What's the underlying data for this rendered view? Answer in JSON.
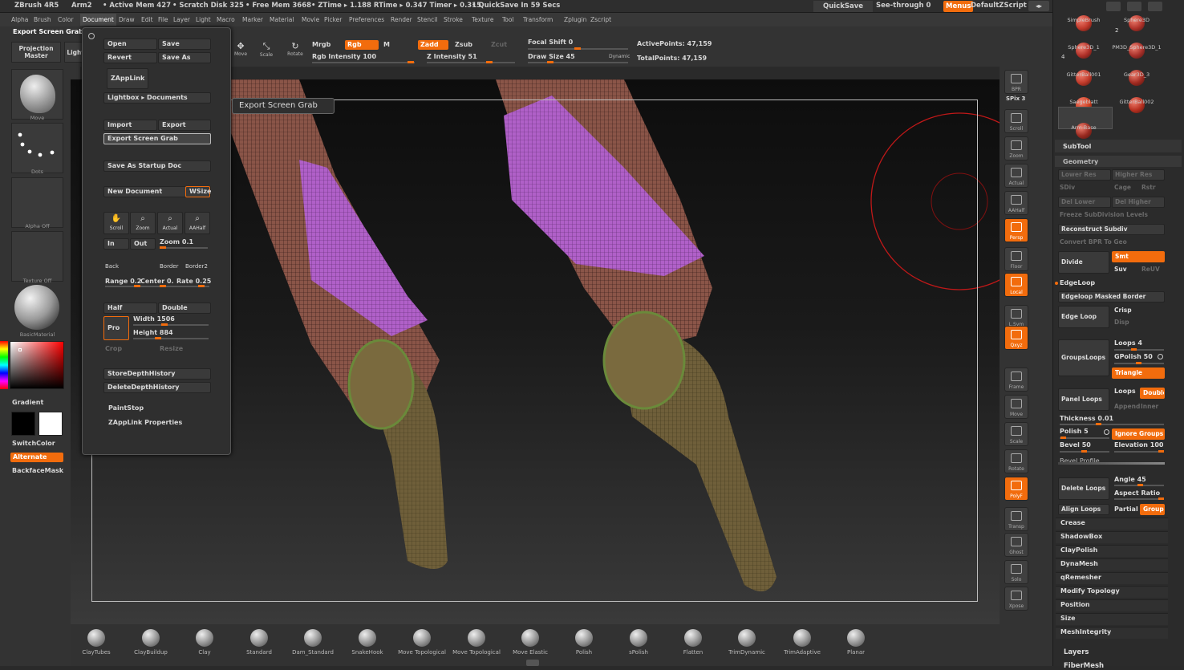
{
  "titlebar": {
    "app": "ZBrush 4R5",
    "doc": "Arm2",
    "active_mem": "• Active Mem 427",
    "scratch": "• Scratch Disk 325",
    "free_mem": "• Free Mem 3668",
    "ztime": "• ZTime ▸ 1.188 RTime ▸ 0.347 Timer ▸ 0.315",
    "quicksave_in": "• QuickSave In 59 Secs",
    "quicksave": "QuickSave",
    "seethrough": "See-through  0",
    "menus": "Menus",
    "script": "DefaultZScript"
  },
  "menubar": [
    "Alpha",
    "Brush",
    "Color",
    "Document",
    "Draw",
    "Edit",
    "File",
    "Layer",
    "Light",
    "Macro",
    "Marker",
    "Material",
    "Movie",
    "Picker",
    "Preferences",
    "Render",
    "Stencil",
    "Stroke",
    "Texture",
    "Tool",
    "Transform",
    "Zplugin",
    "Zscript"
  ],
  "topshelf": {
    "popup_title": "Export Screen Grab",
    "projection_master": "Projection Master",
    "lightbox": "LightBox",
    "move": "Move",
    "scale": "Scale",
    "rotate": "Rotate",
    "mrgb": "Mrgb",
    "rgb": "Rgb",
    "m": "M",
    "rgb_intensity": "Rgb Intensity 100",
    "zadd": "Zadd",
    "zsub": "Zsub",
    "zcut": "Zcut",
    "z_intensity": "Z Intensity 51",
    "focal_shift": "Focal Shift 0",
    "draw_size": "Draw Size 45",
    "dynamic": "Dynamic",
    "active_points": "ActivePoints: 47,159",
    "total_points": "TotalPoints: 47,159"
  },
  "leftshelf": {
    "move": "Move",
    "dots": "Dots",
    "alpha_off": "Alpha Off",
    "texture_off": "Texture Off",
    "basic_material": "BasicMaterial",
    "gradient": "Gradient",
    "switch_color": "SwitchColor",
    "alternate": "Alternate",
    "backface_mask": "BackfaceMask"
  },
  "popup": {
    "open": "Open",
    "save": "Save",
    "revert": "Revert",
    "save_as": "Save As",
    "zapplink": "ZAppLink",
    "lightbox_docs": "Lightbox ▸ Documents",
    "import": "Import",
    "export": "Export",
    "export_screen_grab": "Export Screen Grab",
    "save_startup": "Save As Startup Doc",
    "new_document": "New Document",
    "wsize": "WSize",
    "scroll": "Scroll",
    "zoom": "Zoom",
    "actual": "Actual",
    "aahalf": "AAHalf",
    "in": "In",
    "out": "Out",
    "zoom_val": "Zoom 0.1",
    "back": "Back",
    "border": "Border",
    "border2": "Border2",
    "range": "Range 0.2",
    "center": "Center 0.",
    "rate": "Rate 0.25",
    "half": "Half",
    "double": "Double",
    "pro": "Pro",
    "width": "Width 1506",
    "height": "Height 884",
    "crop": "Crop",
    "resize": "Resize",
    "store_depth": "StoreDepthHistory",
    "delete_depth": "DeleteDepthHistory",
    "paintstop": "PaintStop",
    "zapplink_props": "ZAppLink Properties",
    "tooltip": "Export Screen Grab"
  },
  "righttoolbar": [
    {
      "name": "bpr",
      "label": "BPR",
      "on": false
    },
    {
      "name": "scroll",
      "label": "Scroll",
      "on": false
    },
    {
      "name": "zoom",
      "label": "Zoom",
      "on": false
    },
    {
      "name": "actual",
      "label": "Actual",
      "on": false
    },
    {
      "name": "aahalf",
      "label": "AAHalf",
      "on": false
    },
    {
      "name": "persp",
      "label": "Persp",
      "on": true
    },
    {
      "name": "floor",
      "label": "Floor",
      "on": false
    },
    {
      "name": "local",
      "label": "Local",
      "on": true
    },
    {
      "name": "lsym",
      "label": "L.Sym",
      "on": false
    },
    {
      "name": "xyz",
      "label": "Qxyz",
      "on": true
    },
    {
      "name": "frame",
      "label": "Frame",
      "on": false
    },
    {
      "name": "move",
      "label": "Move",
      "on": false
    },
    {
      "name": "scale",
      "label": "Scale",
      "on": false
    },
    {
      "name": "rotate",
      "label": "Rotate",
      "on": false
    },
    {
      "name": "polyf",
      "label": "PolyF",
      "on": true
    },
    {
      "name": "transp",
      "label": "Transp",
      "on": false
    },
    {
      "name": "ghost",
      "label": "Ghost",
      "on": false
    },
    {
      "name": "solo",
      "label": "Solo",
      "on": false
    },
    {
      "name": "xpose",
      "label": "Xpose",
      "on": false
    }
  ],
  "spix": "SPix 3",
  "rightpanel": {
    "tools": [
      "SimpleBrush",
      "Sphere3D",
      "Sphere3D_1",
      "PM3D_Sphere3D_1",
      "GitterBall001",
      "Gear3D_3",
      "Saegeblatt",
      "GitterBall002",
      "Arm-Base"
    ],
    "tool_counts": [
      "2",
      "4"
    ],
    "subtool": "SubTool",
    "geometry": "Geometry",
    "lower_res": "Lower Res",
    "higher_res": "Higher Res",
    "sdiv": "SDiv",
    "cage": "Cage",
    "rstr": "Rstr",
    "del_lower": "Del Lower",
    "del_higher": "Del Higher",
    "freeze": "Freeze SubDivision Levels",
    "reconstruct": "Reconstruct Subdiv",
    "convert_bpr": "Convert BPR To Geo",
    "divide": "Divide",
    "smt": "Smt",
    "suv": "Suv",
    "reuv": "ReUV",
    "edgeloop": "EdgeLoop",
    "edgeloop_masked": "Edgeloop Masked Border",
    "edge_loop": "Edge Loop",
    "crisp": "Crisp",
    "disp": "Disp",
    "loops4": "Loops 4",
    "gpolish": "GPolish 50",
    "groupsloops": "GroupsLoops",
    "triangle": "Triangle",
    "panel_loops": "Panel Loops",
    "loops": "Loops",
    "double": "Double",
    "append": "Append",
    "inner": "Inner",
    "thickness": "Thickness 0.01",
    "polish": "Polish 5",
    "ignore_groups": "Ignore Groups",
    "bevel": "Bevel 50",
    "elevation": "Elevation 100",
    "bevel_profile": "Bevel Profile",
    "delete_loops": "Delete Loops",
    "angle": "Angle 45",
    "aspect_ratio": "Aspect Ratio",
    "align_loops": "Align Loops",
    "partial": "Partial",
    "groups": "Groups",
    "sections": [
      "Crease",
      "ShadowBox",
      "ClayPolish",
      "DynaMesh",
      "qRemesher",
      "Modify Topology",
      "Position",
      "Size",
      "MeshIntegrity"
    ],
    "layers": "Layers",
    "fibermesh": "FiberMesh"
  },
  "bottomshelf": [
    "ClayTubes",
    "ClayBuildup",
    "Clay",
    "Standard",
    "Dam_Standard",
    "SnakeHook",
    "Move Topological",
    "Move Topological",
    "Move Elastic",
    "Polish",
    "sPolish",
    "Flatten",
    "TrimDynamic",
    "TrimAdaptive",
    "Planar"
  ],
  "colors": {
    "accent": "#f26c0d",
    "panel": "#2b2b2b",
    "viewport_top": "#0d0d0d",
    "viewport_bottom": "#3a3a3a"
  }
}
